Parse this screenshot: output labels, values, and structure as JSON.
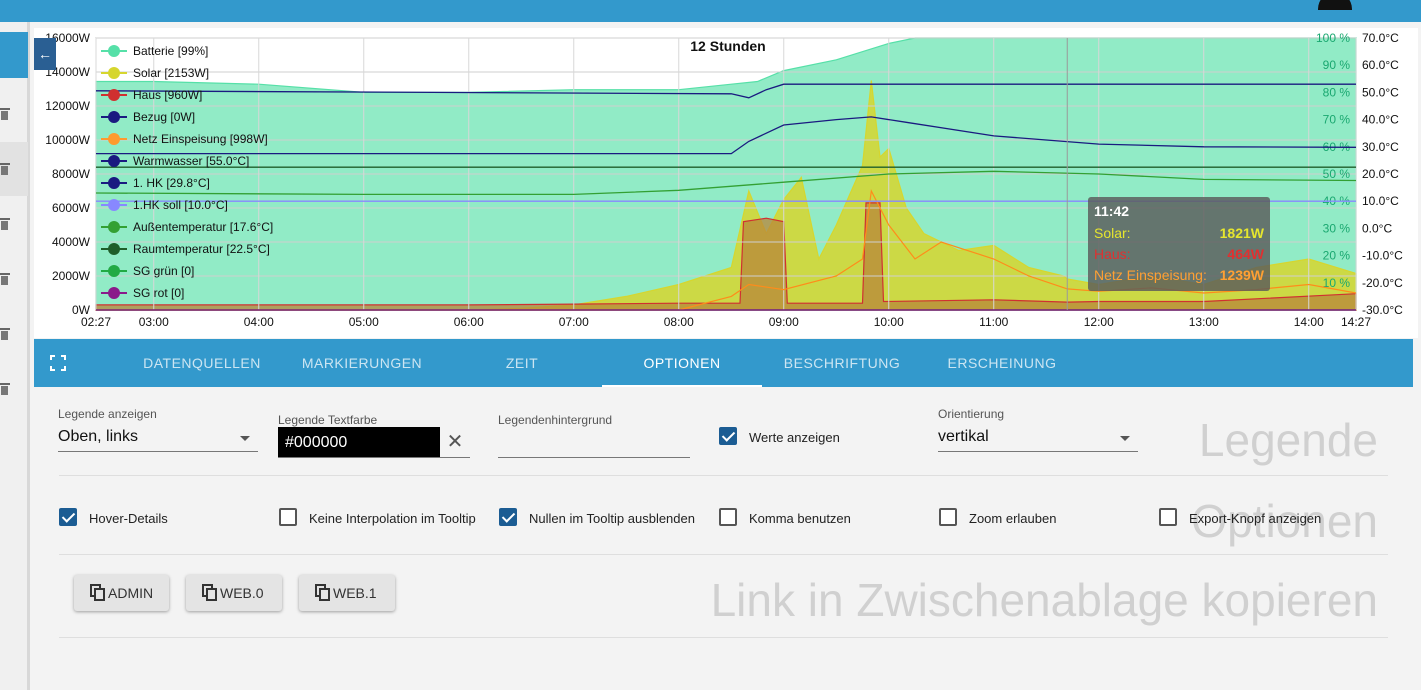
{
  "chart_data": {
    "type": "area",
    "title": "12 Stunden",
    "x_ticks": [
      "02:27",
      "03:00",
      "04:00",
      "05:00",
      "06:00",
      "07:00",
      "08:00",
      "09:00",
      "10:00",
      "11:00",
      "12:00",
      "13:00",
      "14:00",
      "14:27"
    ],
    "y_left_ticks": [
      "16000W",
      "14000W",
      "12000W",
      "10000W",
      "8000W",
      "6000W",
      "4000W",
      "2000W",
      "0W"
    ],
    "y_mid_ticks": [
      "100 %",
      "90 %",
      "80 %",
      "70 %",
      "60 %",
      "50 %",
      "40 %",
      "30 %",
      "20 %",
      "10 %"
    ],
    "y_right_ticks": [
      "70.0°C",
      "60.0°C",
      "50.0°C",
      "40.0°C",
      "30.0°C",
      "20.0°C",
      "10.0°C",
      "0.0°C",
      "-10.0°C",
      "-20.0°C",
      "-30.0°C"
    ],
    "y_left_range": [
      0,
      16000
    ],
    "y_pct_range": [
      0,
      100
    ],
    "y_temp_range": [
      -30,
      70
    ],
    "x_range": [
      "02:27",
      "14:27"
    ],
    "series": [
      {
        "name": "Batterie",
        "unit": "%",
        "color": "#56e0a8",
        "points": [
          [
            "02:27",
            84
          ],
          [
            "03:00",
            84
          ],
          [
            "04:00",
            83
          ],
          [
            "05:00",
            80
          ],
          [
            "06:00",
            80
          ],
          [
            "07:00",
            81
          ],
          [
            "08:00",
            81
          ],
          [
            "08:30",
            83
          ],
          [
            "08:45",
            84
          ],
          [
            "09:00",
            88
          ],
          [
            "09:30",
            92
          ],
          [
            "10:00",
            98
          ],
          [
            "10:15",
            100
          ],
          [
            "11:00",
            100
          ],
          [
            "12:00",
            100
          ],
          [
            "13:00",
            100
          ],
          [
            "14:27",
            100
          ]
        ]
      },
      {
        "name": "Solar",
        "unit": "W",
        "color": "#d6d62e",
        "points": [
          [
            "02:27",
            0
          ],
          [
            "06:00",
            0
          ],
          [
            "06:30",
            100
          ],
          [
            "07:00",
            300
          ],
          [
            "07:30",
            800
          ],
          [
            "08:00",
            1500
          ],
          [
            "08:30",
            2500
          ],
          [
            "08:40",
            7000
          ],
          [
            "08:50",
            4500
          ],
          [
            "09:00",
            6500
          ],
          [
            "09:10",
            7800
          ],
          [
            "09:20",
            3000
          ],
          [
            "09:30",
            5000
          ],
          [
            "09:45",
            8500
          ],
          [
            "09:50",
            13500
          ],
          [
            "09:55",
            9000
          ],
          [
            "10:00",
            9500
          ],
          [
            "10:10",
            6000
          ],
          [
            "10:20",
            4500
          ],
          [
            "10:40",
            3500
          ],
          [
            "11:00",
            3800
          ],
          [
            "11:20",
            2500
          ],
          [
            "11:40",
            2000
          ],
          [
            "11:42",
            1821
          ],
          [
            "12:00",
            1500
          ],
          [
            "12:30",
            2000
          ],
          [
            "13:00",
            1500
          ],
          [
            "13:30",
            2500
          ],
          [
            "14:00",
            3000
          ],
          [
            "14:27",
            2153
          ]
        ]
      },
      {
        "name": "Haus",
        "unit": "W",
        "color": "#d03030",
        "points": [
          [
            "02:27",
            300
          ],
          [
            "06:00",
            300
          ],
          [
            "07:00",
            350
          ],
          [
            "08:00",
            400
          ],
          [
            "08:35",
            400
          ],
          [
            "08:37",
            5200
          ],
          [
            "08:50",
            5400
          ],
          [
            "09:00",
            5200
          ],
          [
            "09:02",
            400
          ],
          [
            "09:45",
            400
          ],
          [
            "09:47",
            6300
          ],
          [
            "09:55",
            6300
          ],
          [
            "09:57",
            500
          ],
          [
            "11:00",
            600
          ],
          [
            "11:42",
            464
          ],
          [
            "12:00",
            500
          ],
          [
            "13:00",
            500
          ],
          [
            "14:27",
            960
          ]
        ]
      },
      {
        "name": "Bezug",
        "unit": "W",
        "color": "#1a1a80",
        "points": [
          [
            "02:27",
            0
          ],
          [
            "14:27",
            0
          ]
        ]
      },
      {
        "name": "Netz Einspeisung",
        "unit": "W",
        "color": "#ff8c1a",
        "points": [
          [
            "02:27",
            0
          ],
          [
            "08:00",
            0
          ],
          [
            "08:30",
            800
          ],
          [
            "08:40",
            1500
          ],
          [
            "09:00",
            1200
          ],
          [
            "09:30",
            2000
          ],
          [
            "09:45",
            3000
          ],
          [
            "09:50",
            7000
          ],
          [
            "10:00",
            5000
          ],
          [
            "10:15",
            3000
          ],
          [
            "10:30",
            4000
          ],
          [
            "11:00",
            3000
          ],
          [
            "11:20",
            2000
          ],
          [
            "11:42",
            1239
          ],
          [
            "12:00",
            1100
          ],
          [
            "12:30",
            1300
          ],
          [
            "13:00",
            1000
          ],
          [
            "13:30",
            1200
          ],
          [
            "14:00",
            1500
          ],
          [
            "14:27",
            998
          ]
        ]
      },
      {
        "name": "Warmwasser",
        "unit": "°C",
        "color": "#1a1a80",
        "points": [
          [
            "02:27",
            50.6
          ],
          [
            "08:30",
            49.5
          ],
          [
            "08:40",
            48
          ],
          [
            "08:50",
            51
          ],
          [
            "09:00",
            53
          ],
          [
            "12:00",
            53
          ],
          [
            "14:27",
            53
          ]
        ]
      },
      {
        "name": "1. HK",
        "unit": "°C",
        "color": "#1a1a80",
        "points": [
          [
            "02:27",
            27.5
          ],
          [
            "08:30",
            27.5
          ],
          [
            "08:40",
            32
          ],
          [
            "09:00",
            38
          ],
          [
            "09:30",
            40
          ],
          [
            "09:50",
            41
          ],
          [
            "10:10",
            39
          ],
          [
            "11:00",
            34
          ],
          [
            "12:00",
            31
          ],
          [
            "13:00",
            30
          ],
          [
            "14:27",
            29.8
          ]
        ]
      },
      {
        "name": "1.HK soll",
        "unit": "°C",
        "color": "#8888ff",
        "points": [
          [
            "02:27",
            10
          ],
          [
            "14:27",
            10
          ]
        ]
      },
      {
        "name": "Außentemperatur",
        "unit": "°C",
        "color": "#33a033",
        "points": [
          [
            "02:27",
            13
          ],
          [
            "05:00",
            12.5
          ],
          [
            "07:00",
            12.5
          ],
          [
            "08:00",
            14
          ],
          [
            "09:00",
            17
          ],
          [
            "10:00",
            20
          ],
          [
            "11:00",
            21
          ],
          [
            "12:00",
            20
          ],
          [
            "13:00",
            18
          ],
          [
            "14:27",
            17.6
          ]
        ]
      },
      {
        "name": "Raumtemperatur",
        "unit": "°C",
        "color": "#1f5e2a",
        "points": [
          [
            "02:27",
            22.5
          ],
          [
            "14:27",
            22.5
          ]
        ]
      },
      {
        "name": "SG grün",
        "unit": "",
        "color": "#22aa44",
        "points": [
          [
            "02:27",
            0
          ],
          [
            "14:27",
            0
          ]
        ]
      },
      {
        "name": "SG rot",
        "unit": "",
        "color": "#8a1a8a",
        "points": [
          [
            "02:27",
            0
          ],
          [
            "14:27",
            0
          ]
        ]
      }
    ],
    "legend": [
      {
        "label": "Batterie [99%]",
        "color": "#56e0a8"
      },
      {
        "label": "Solar [2153W]",
        "color": "#d6d62e"
      },
      {
        "label": "Haus [960W]",
        "color": "#d03030"
      },
      {
        "label": "Bezug [0W]",
        "color": "#1a1a80"
      },
      {
        "label": "Netz Einspeisung [998W]",
        "color": "#ff9a2e"
      },
      {
        "label": "Warmwasser [55.0°C]",
        "color": "#1a1a80"
      },
      {
        "label": "1. HK [29.8°C]",
        "color": "#1a1a80"
      },
      {
        "label": "1.HK soll [10.0°C]",
        "color": "#8888ff"
      },
      {
        "label": "Außentemperatur [17.6°C]",
        "color": "#33a033"
      },
      {
        "label": "Raumtemperatur [22.5°C]",
        "color": "#1f5e2a"
      },
      {
        "label": "SG grün [0]",
        "color": "#22aa44"
      },
      {
        "label": "SG rot [0]",
        "color": "#8a1a8a"
      }
    ],
    "legend_position": "top-left",
    "grid": true,
    "tooltip": {
      "time": "11:42",
      "rows": [
        {
          "label": "Solar:",
          "value": "1821W",
          "color": "#e6e62e"
        },
        {
          "label": "Haus:",
          "value": "464W",
          "color": "#e03030"
        },
        {
          "label": "Netz Einspeisung:",
          "value": "1239W",
          "color": "#ffa033"
        }
      ]
    }
  },
  "tabs": [
    {
      "label": "DATENQUELLEN",
      "active": false
    },
    {
      "label": "MARKIERUNGEN",
      "active": false
    },
    {
      "label": "ZEIT",
      "active": false
    },
    {
      "label": "OPTIONEN",
      "active": true
    },
    {
      "label": "BESCHRIFTUNG",
      "active": false
    },
    {
      "label": "ERSCHEINUNG",
      "active": false
    }
  ],
  "options": {
    "legend_show_label": "Legende anzeigen",
    "legend_show_value": "Oben, links",
    "legend_textcolor_label": "Legende Textfarbe",
    "legend_textcolor_value": "#000000",
    "legend_bg_label": "Legendenhintergrund",
    "legend_bg_value": "",
    "show_values_label": "Werte anzeigen",
    "orientation_label": "Orientierung",
    "orientation_value": "vertikal",
    "section_legend": "Legende",
    "section_options": "Optionen",
    "section_link": "Link in Zwischenablage kopieren",
    "checkboxes": [
      {
        "label": "Hover-Details",
        "checked": true
      },
      {
        "label": "Keine Interpolation im Tooltip",
        "checked": false
      },
      {
        "label": "Nullen im Tooltip ausblenden",
        "checked": true
      },
      {
        "label": "Komma benutzen",
        "checked": false
      },
      {
        "label": "Zoom erlauben",
        "checked": false
      },
      {
        "label": "Export-Knopf anzeigen",
        "checked": false
      }
    ],
    "copy_buttons": [
      "ADMIN",
      "WEB.0",
      "WEB.1"
    ]
  }
}
